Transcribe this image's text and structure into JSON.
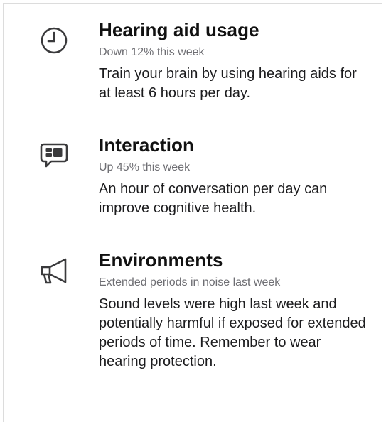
{
  "cards": [
    {
      "icon": "clock-icon",
      "title": "Hearing aid usage",
      "subtitle": "Down 12% this week",
      "body": "Train your brain by using hearing aids for at least 6 hours per day."
    },
    {
      "icon": "speech-bubble-icon",
      "title": "Interaction",
      "subtitle": "Up 45% this week",
      "body": "An hour of conversation per day can improve cognitive health."
    },
    {
      "icon": "megaphone-icon",
      "title": "Environments",
      "subtitle": "Extended periods in noise last week",
      "body": "Sound levels were high last week and potentially harmful if exposed for extended periods of time. Remember to wear hearing protection."
    }
  ],
  "colors": {
    "subtitle": "#6e6e73",
    "icon_stroke": "#3a3a3c",
    "border": "#dcdcdc"
  }
}
